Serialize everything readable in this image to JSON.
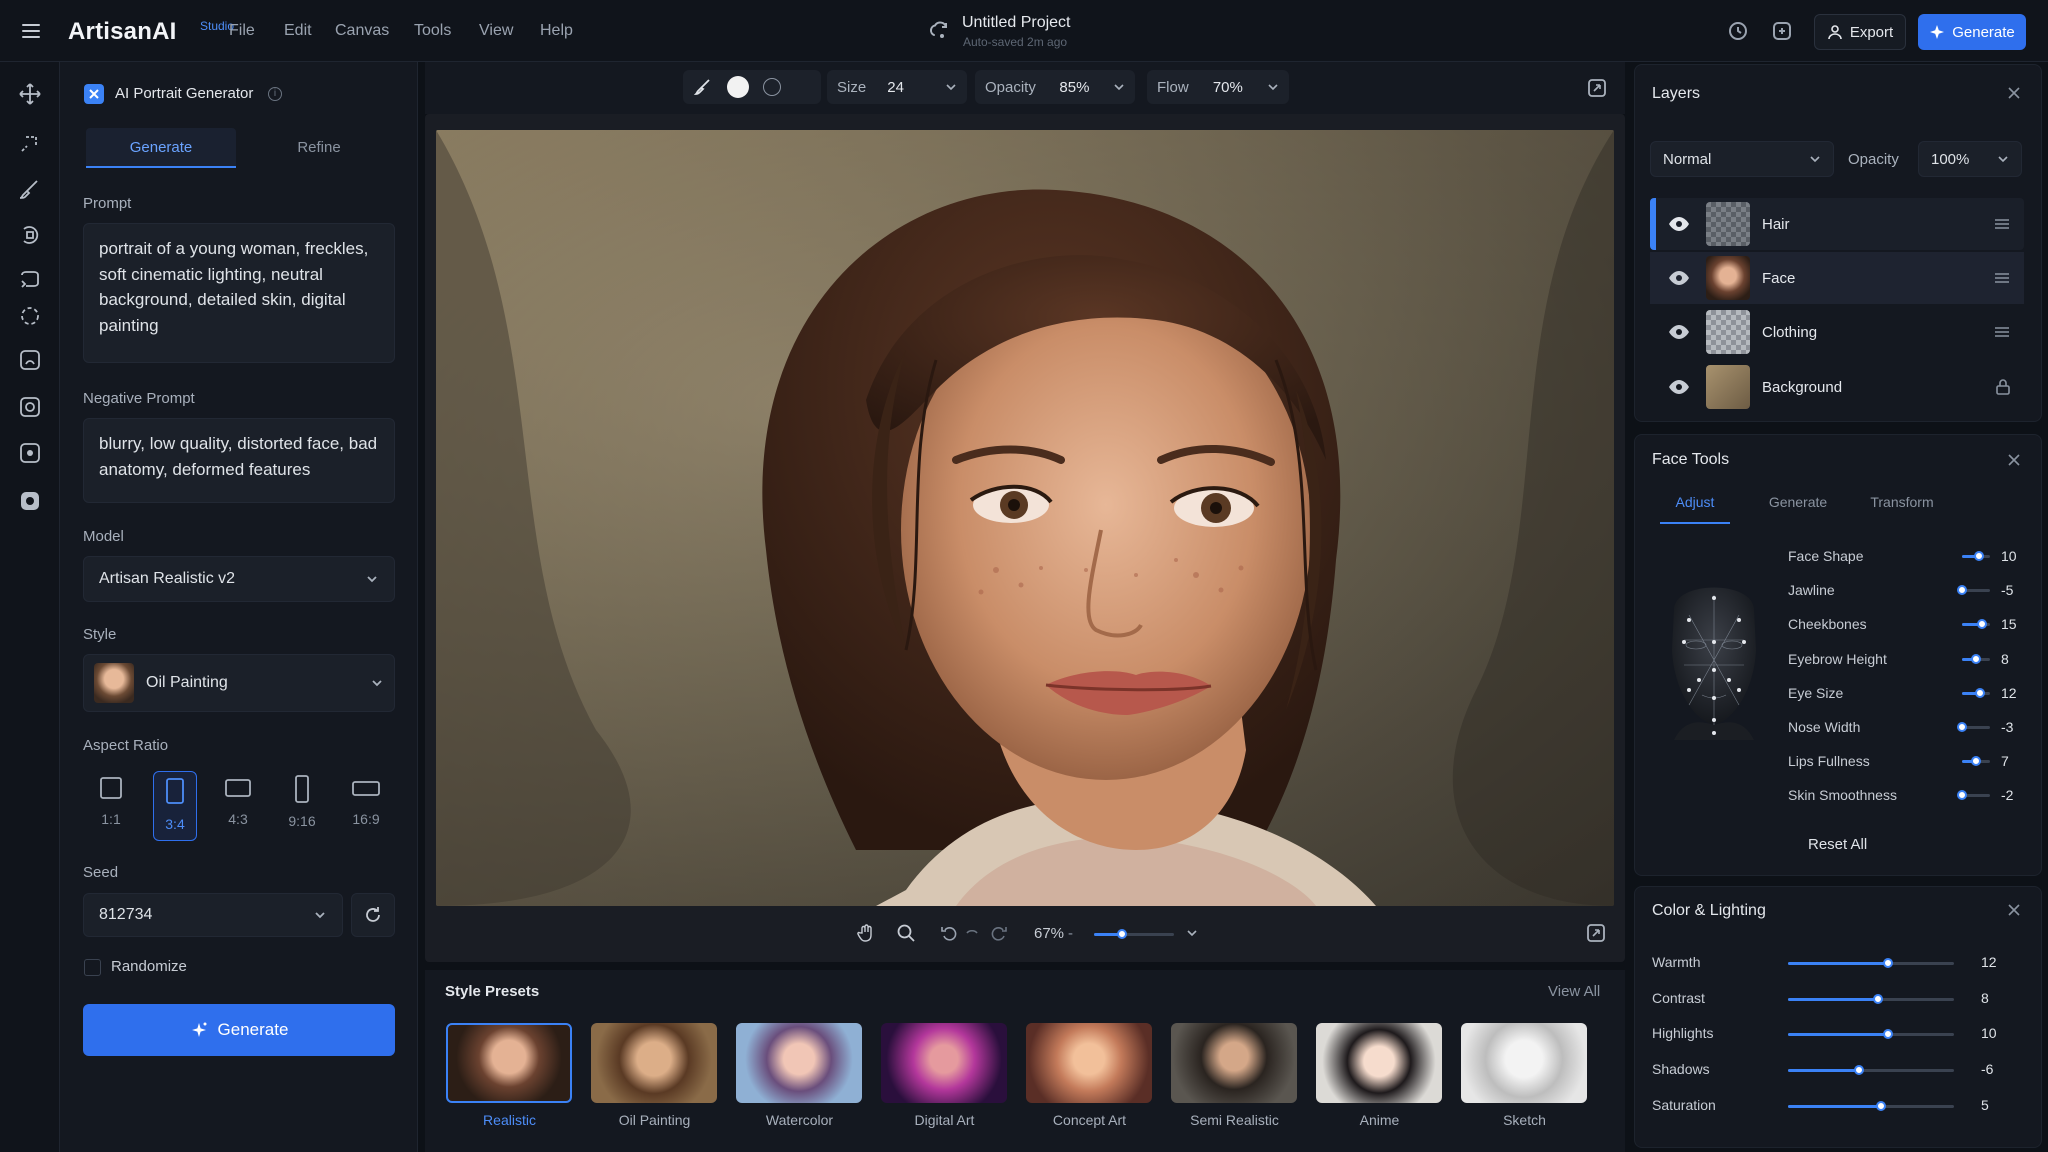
{
  "brand": {
    "name": "ArtisanAI",
    "badge": "Studio"
  },
  "menu": [
    "File",
    "Edit",
    "Canvas",
    "Tools",
    "View",
    "Help"
  ],
  "project": {
    "title": "Untitled Project",
    "status": "Auto-saved 2m ago"
  },
  "topbar": {
    "export_label": "Export",
    "generate_label": "Generate"
  },
  "colors": {
    "accent": "#2f6fed",
    "bg": "#0d1117",
    "panel": "#141820"
  },
  "generator": {
    "title": "AI Portrait Generator",
    "tabs": [
      "Generate",
      "Refine"
    ],
    "active_tab": "Generate",
    "prompt_label": "Prompt",
    "prompt": "portrait of a young woman, freckles, soft cinematic lighting, neutral background, detailed skin, digital painting",
    "negative_label": "Negative Prompt",
    "negative": "blurry, low quality, distorted face, bad anatomy, deformed features",
    "model_label": "Model",
    "model": "Artisan Realistic v2",
    "style_label": "Style",
    "style": "Oil Painting",
    "aspect_label": "Aspect Ratio",
    "aspect_ratios": [
      "1:1",
      "3:4",
      "4:3",
      "9:16",
      "16:9"
    ],
    "aspect_selected": "3:4",
    "seed_label": "Seed",
    "seed": "812734",
    "randomize_label": "Randomize",
    "generate_label": "Generate"
  },
  "brush": {
    "size_label": "Size",
    "size": "24",
    "opacity_label": "Opacity",
    "opacity": "85%",
    "flow_label": "Flow",
    "flow": "70%"
  },
  "canvas": {
    "zoom": "67%",
    "zoom_fraction": 0.35
  },
  "layers": {
    "title": "Layers",
    "blend": "Normal",
    "opacity_label": "Opacity",
    "opacity": "100%",
    "items": [
      {
        "name": "Hair",
        "active": true
      },
      {
        "name": "Face",
        "active": false
      },
      {
        "name": "Clothing",
        "active": false
      },
      {
        "name": "Background",
        "active": false,
        "locked": true
      }
    ]
  },
  "face_tools": {
    "title": "Face Tools",
    "tabs": [
      "Adjust",
      "Generate",
      "Transform"
    ],
    "active_tab": "Adjust",
    "sliders": [
      {
        "label": "Face Shape",
        "value": "10",
        "level": 0.6
      },
      {
        "label": "Jawline",
        "value": "-5",
        "level": 0.0
      },
      {
        "label": "Cheekbones",
        "value": "15",
        "level": 0.7
      },
      {
        "label": "Eyebrow Height",
        "value": "8",
        "level": 0.5
      },
      {
        "label": "Eye Size",
        "value": "12",
        "level": 0.65
      },
      {
        "label": "Nose Width",
        "value": "-3",
        "level": 0.0
      },
      {
        "label": "Lips Fullness",
        "value": "7",
        "level": 0.5
      },
      {
        "label": "Skin Smoothness",
        "value": "-2",
        "level": 0.0
      }
    ],
    "reset_label": "Reset All"
  },
  "color_lighting": {
    "title": "Color & Lighting",
    "sliders": [
      {
        "label": "Warmth",
        "value": "12",
        "level": 0.6
      },
      {
        "label": "Contrast",
        "value": "8",
        "level": 0.54
      },
      {
        "label": "Highlights",
        "value": "10",
        "level": 0.6
      },
      {
        "label": "Shadows",
        "value": "-6",
        "level": 0.43
      },
      {
        "label": "Saturation",
        "value": "5",
        "level": 0.56
      }
    ]
  },
  "presets": {
    "title": "Style Presets",
    "view_all": "View All",
    "items": [
      "Realistic",
      "Oil Painting",
      "Watercolor",
      "Digital Art",
      "Concept Art",
      "Semi Realistic",
      "Anime",
      "Sketch"
    ],
    "selected": "Realistic"
  }
}
